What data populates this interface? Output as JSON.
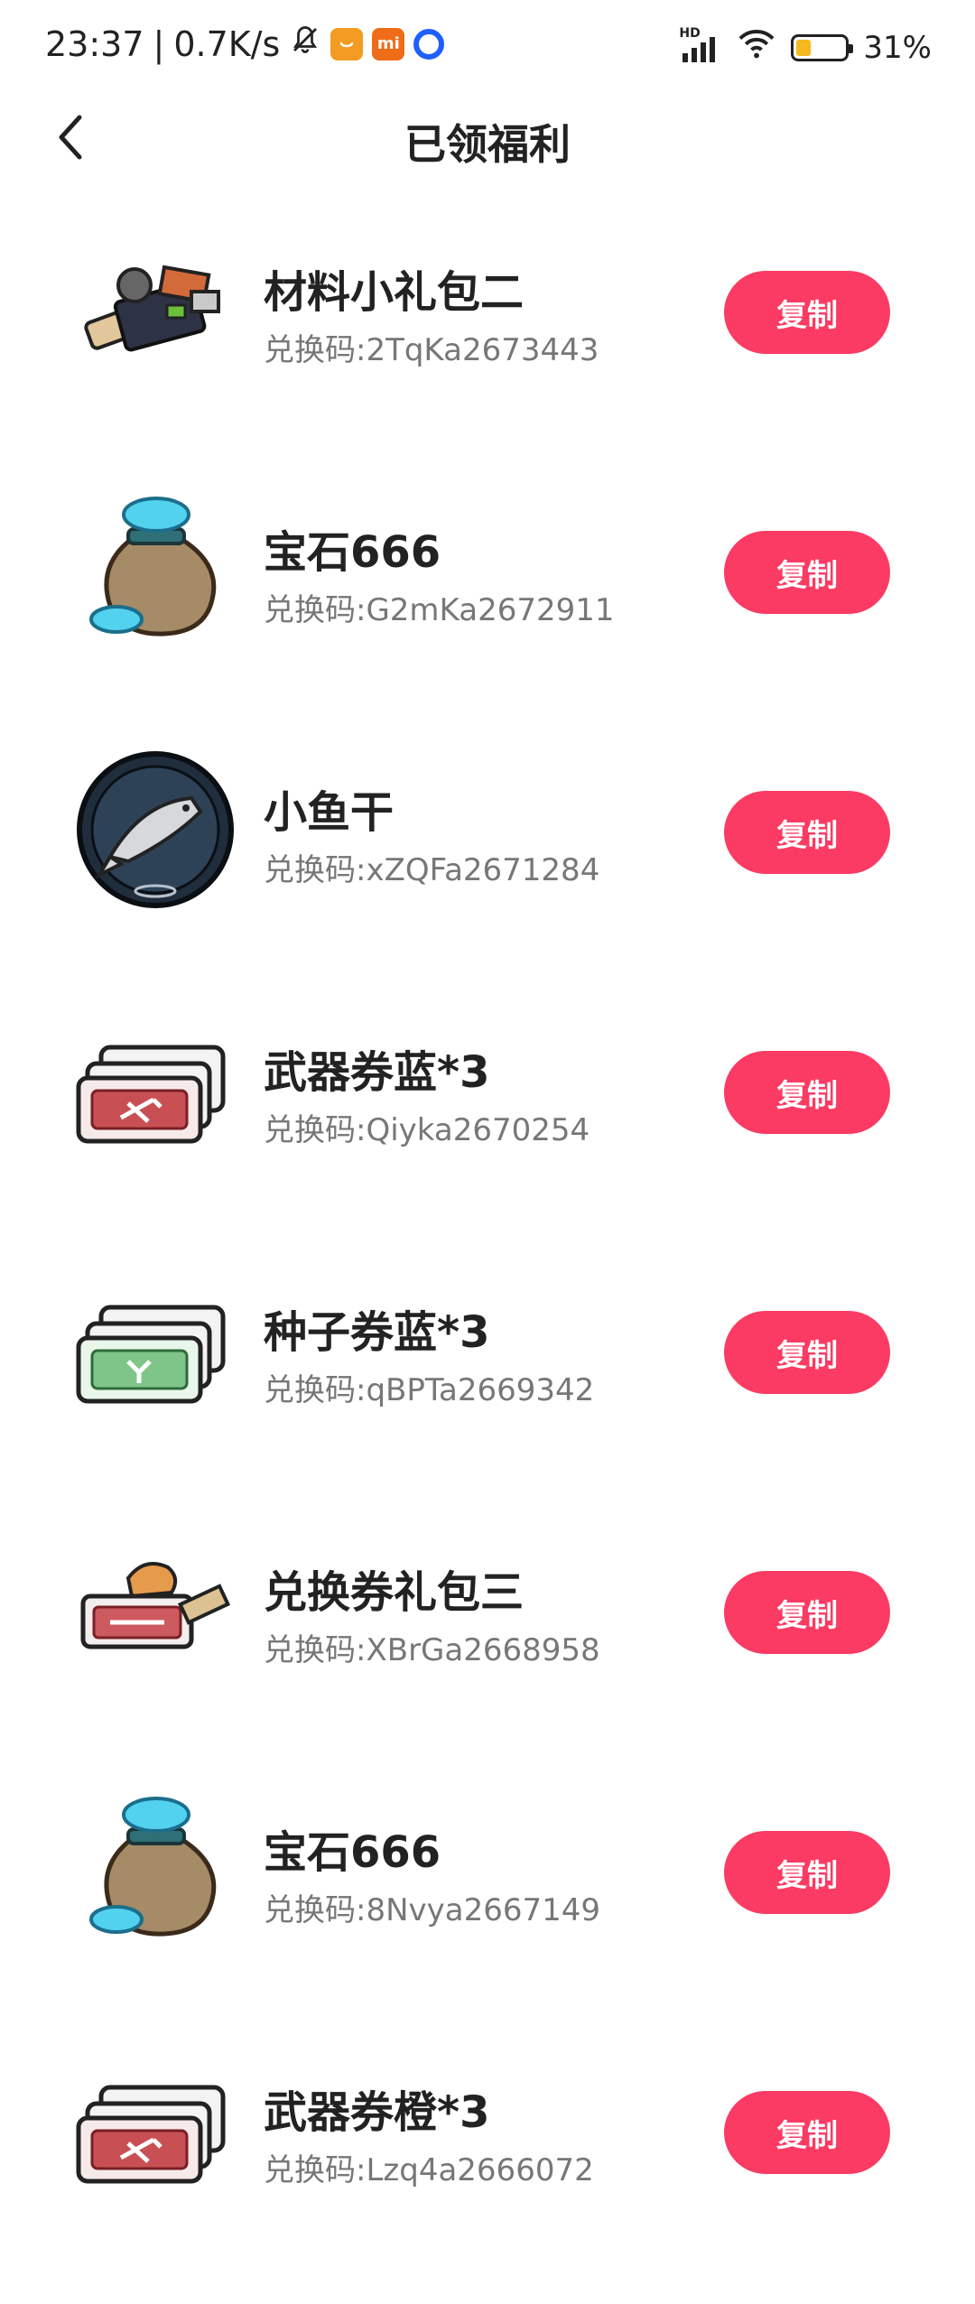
{
  "status_bar": {
    "time": "23:37",
    "separator": "|",
    "net_speed": "0.7K/s",
    "mi_badge": "mi",
    "hd_label": "HD",
    "battery_percent_text": "31%",
    "battery_level": 0.31
  },
  "nav": {
    "title": "已领福利"
  },
  "colors": {
    "accent": "#fb3b63",
    "code_text": "#777777"
  },
  "items": [
    {
      "title": "材料小礼包二",
      "code": "兑换码:2TqKa2673443",
      "button": "复制",
      "icon": "material-pack-icon"
    },
    {
      "title": "宝石666",
      "code": "兑换码:G2mKa2672911",
      "button": "复制",
      "icon": "gem-bag-icon"
    },
    {
      "title": "小鱼干",
      "code": "兑换码:xZQFa2671284",
      "button": "复制",
      "icon": "dried-fish-icon"
    },
    {
      "title": "武器券蓝*3",
      "code": "兑换码:Qiyka2670254",
      "button": "复制",
      "icon": "weapon-ticket-icon"
    },
    {
      "title": "种子券蓝*3",
      "code": "兑换码:qBPTa2669342",
      "button": "复制",
      "icon": "seed-ticket-icon"
    },
    {
      "title": "兑换券礼包三",
      "code": "兑换码:XBrGa2668958",
      "button": "复制",
      "icon": "voucher-pack-icon"
    },
    {
      "title": "宝石666",
      "code": "兑换码:8Nvya2667149",
      "button": "复制",
      "icon": "gem-bag-icon"
    },
    {
      "title": "武器券橙*3",
      "code": "兑换码:Lzq4a2666072",
      "button": "复制",
      "icon": "weapon-ticket-icon"
    }
  ]
}
